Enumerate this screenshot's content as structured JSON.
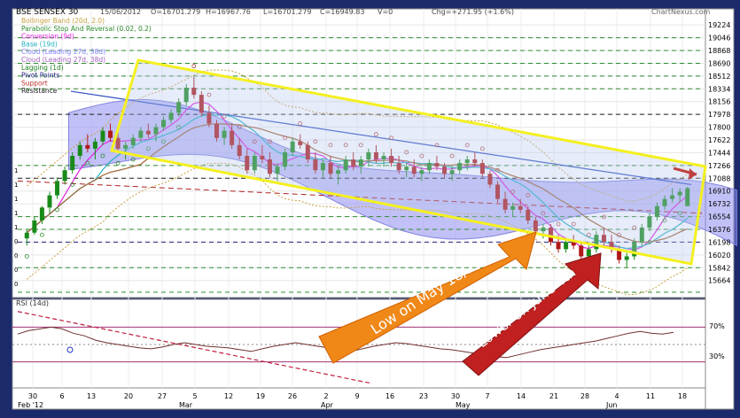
{
  "header": {
    "symbol": "BSE SENSEX 30",
    "date": "15/06/2012",
    "open": "O=16701.279",
    "high": "H=16967.76",
    "low": "L=16701.279",
    "close": "C=16949.83",
    "volume": "V=0",
    "change": "Chg=+271.95 (+1.6%)",
    "brand": "ChartNexus.com"
  },
  "legend": [
    {
      "label": "Bollinger Band (20d, 2.0)",
      "color": "#c8a040"
    },
    {
      "label": "Parabolic Stop And Reversal (0.02, 0.2)",
      "color": "#2e8b2e"
    },
    {
      "label": "Conversion (9d)",
      "color": "#e020e0"
    },
    {
      "label": "Base (19d)",
      "color": "#20b0c0"
    },
    {
      "label": "Cloud (Leading 27d, 38d)",
      "color": "#8080ff"
    },
    {
      "label": "Cloud (Leading 27d, 38d)",
      "color": "#a060c0"
    },
    {
      "label": "Lagging (1d)",
      "color": "#208020"
    },
    {
      "label": "Pivot Points",
      "color": "#202080"
    },
    {
      "label": "Support",
      "color": "#c03030"
    },
    {
      "label": "Resistance",
      "color": "#202020"
    }
  ],
  "annotations": {
    "arrow1": "Low on May 18/23",
    "arrow2": "Lower on June 4th"
  },
  "rsi": {
    "label": "RSI (14d)",
    "level_high": "70%",
    "level_low": "30%"
  },
  "colors": {
    "frame": "#1b2a6b",
    "up": "#1a8a1a",
    "down": "#b01818",
    "channel": "#f4f020"
  },
  "chart_data": {
    "type": "candlestick",
    "title": "BSE SENSEX 30",
    "y_ticks": [
      "19224",
      "19046",
      "18868",
      "18690",
      "18512",
      "18334",
      "18156",
      "17978",
      "17800",
      "17622",
      "17444",
      "17266",
      "17088",
      "16910",
      "16732",
      "16554",
      "16376",
      "16198",
      "16020",
      "15842",
      "15664"
    ],
    "ylim": [
      15500,
      19300
    ],
    "x_ticks": [
      "30",
      "6",
      "13",
      "20",
      "27",
      "5",
      "12",
      "19",
      "26",
      "2",
      "9",
      "16",
      "23",
      "30",
      "7",
      "14",
      "21",
      "28",
      "4",
      "11",
      "18"
    ],
    "month_labels": [
      "Feb '12",
      "Mar",
      "Apr",
      "May",
      "Jun"
    ],
    "candles": [
      [
        16250,
        16380,
        16150,
        16330
      ],
      [
        16330,
        16550,
        16300,
        16500
      ],
      [
        16500,
        16700,
        16450,
        16680
      ],
      [
        16680,
        16900,
        16600,
        16850
      ],
      [
        16850,
        17100,
        16800,
        17050
      ],
      [
        17050,
        17250,
        17000,
        17200
      ],
      [
        17200,
        17450,
        17150,
        17400
      ],
      [
        17400,
        17600,
        17350,
        17550
      ],
      [
        17550,
        17700,
        17450,
        17500
      ],
      [
        17500,
        17650,
        17350,
        17600
      ],
      [
        17600,
        17800,
        17550,
        17750
      ],
      [
        17750,
        17850,
        17600,
        17650
      ],
      [
        17650,
        17750,
        17450,
        17500
      ],
      [
        17500,
        17600,
        17350,
        17550
      ],
      [
        17550,
        17700,
        17500,
        17650
      ],
      [
        17650,
        17800,
        17600,
        17750
      ],
      [
        17750,
        17850,
        17650,
        17700
      ],
      [
        17700,
        17850,
        17600,
        17800
      ],
      [
        17800,
        17950,
        17750,
        17900
      ],
      [
        17900,
        18050,
        17850,
        18000
      ],
      [
        18000,
        18200,
        17950,
        18150
      ],
      [
        18150,
        18400,
        18100,
        18350
      ],
      [
        18350,
        18500,
        18200,
        18250
      ],
      [
        18250,
        18300,
        17950,
        18000
      ],
      [
        18000,
        18100,
        17800,
        17850
      ],
      [
        17850,
        17900,
        17600,
        17650
      ],
      [
        17650,
        17800,
        17550,
        17750
      ],
      [
        17750,
        17850,
        17500,
        17550
      ],
      [
        17550,
        17650,
        17350,
        17400
      ],
      [
        17400,
        17500,
        17150,
        17200
      ],
      [
        17200,
        17450,
        17150,
        17400
      ],
      [
        17400,
        17550,
        17300,
        17350
      ],
      [
        17350,
        17450,
        17100,
        17150
      ],
      [
        17150,
        17300,
        17050,
        17250
      ],
      [
        17250,
        17500,
        17200,
        17450
      ],
      [
        17450,
        17650,
        17400,
        17600
      ],
      [
        17600,
        17700,
        17500,
        17550
      ],
      [
        17550,
        17600,
        17300,
        17350
      ],
      [
        17350,
        17450,
        17150,
        17200
      ],
      [
        17200,
        17350,
        17100,
        17300
      ],
      [
        17300,
        17400,
        17100,
        17150
      ],
      [
        17150,
        17250,
        17000,
        17200
      ],
      [
        17200,
        17400,
        17150,
        17350
      ],
      [
        17350,
        17450,
        17200,
        17250
      ],
      [
        17250,
        17400,
        17150,
        17350
      ],
      [
        17350,
        17500,
        17250,
        17450
      ],
      [
        17450,
        17550,
        17300,
        17350
      ],
      [
        17350,
        17450,
        17250,
        17400
      ],
      [
        17400,
        17500,
        17250,
        17300
      ],
      [
        17300,
        17400,
        17150,
        17200
      ],
      [
        17200,
        17300,
        17100,
        17250
      ],
      [
        17250,
        17350,
        17100,
        17150
      ],
      [
        17150,
        17250,
        17050,
        17200
      ],
      [
        17200,
        17350,
        17150,
        17300
      ],
      [
        17300,
        17400,
        17200,
        17250
      ],
      [
        17250,
        17300,
        17100,
        17150
      ],
      [
        17150,
        17250,
        17050,
        17200
      ],
      [
        17200,
        17350,
        17150,
        17300
      ],
      [
        17300,
        17400,
        17200,
        17350
      ],
      [
        17350,
        17450,
        17250,
        17300
      ],
      [
        17300,
        17350,
        17100,
        17150
      ],
      [
        17150,
        17200,
        16950,
        17000
      ],
      [
        17000,
        17050,
        16750,
        16800
      ],
      [
        16800,
        16900,
        16600,
        16650
      ],
      [
        16650,
        16750,
        16550,
        16700
      ],
      [
        16700,
        16800,
        16600,
        16650
      ],
      [
        16650,
        16700,
        16450,
        16500
      ],
      [
        16500,
        16550,
        16300,
        16350
      ],
      [
        16350,
        16450,
        16250,
        16400
      ],
      [
        16400,
        16450,
        16150,
        16200
      ],
      [
        16200,
        16300,
        16050,
        16100
      ],
      [
        16100,
        16250,
        16050,
        16200
      ],
      [
        16200,
        16300,
        16100,
        16150
      ],
      [
        16150,
        16200,
        15950,
        16000
      ],
      [
        16000,
        16150,
        15950,
        16100
      ],
      [
        16100,
        16350,
        16050,
        16300
      ],
      [
        16300,
        16400,
        16150,
        16200
      ],
      [
        16200,
        16300,
        16050,
        16100
      ],
      [
        16100,
        16150,
        15900,
        15950
      ],
      [
        15950,
        16050,
        15850,
        16000
      ],
      [
        16000,
        16250,
        15950,
        16200
      ],
      [
        16200,
        16450,
        16150,
        16400
      ],
      [
        16400,
        16600,
        16350,
        16550
      ],
      [
        16550,
        16750,
        16500,
        16700
      ],
      [
        16700,
        16850,
        16650,
        16800
      ],
      [
        16800,
        16950,
        16750,
        16850
      ],
      [
        16850,
        16950,
        16750,
        16900
      ],
      [
        16700,
        16968,
        16701,
        16950
      ]
    ],
    "rsi_values": [
      62,
      66,
      68,
      70,
      68,
      63,
      60,
      55,
      52,
      50,
      48,
      46,
      45,
      47,
      50,
      52,
      50,
      48,
      47,
      46,
      44,
      42,
      45,
      48,
      50,
      52,
      50,
      48,
      46,
      44,
      42,
      45,
      48,
      50,
      52,
      51,
      49,
      47,
      45,
      44,
      42,
      40,
      38,
      36,
      35,
      38,
      41,
      44,
      46,
      48,
      50,
      52,
      54,
      57,
      60,
      63,
      65,
      63,
      62,
      64
    ]
  }
}
